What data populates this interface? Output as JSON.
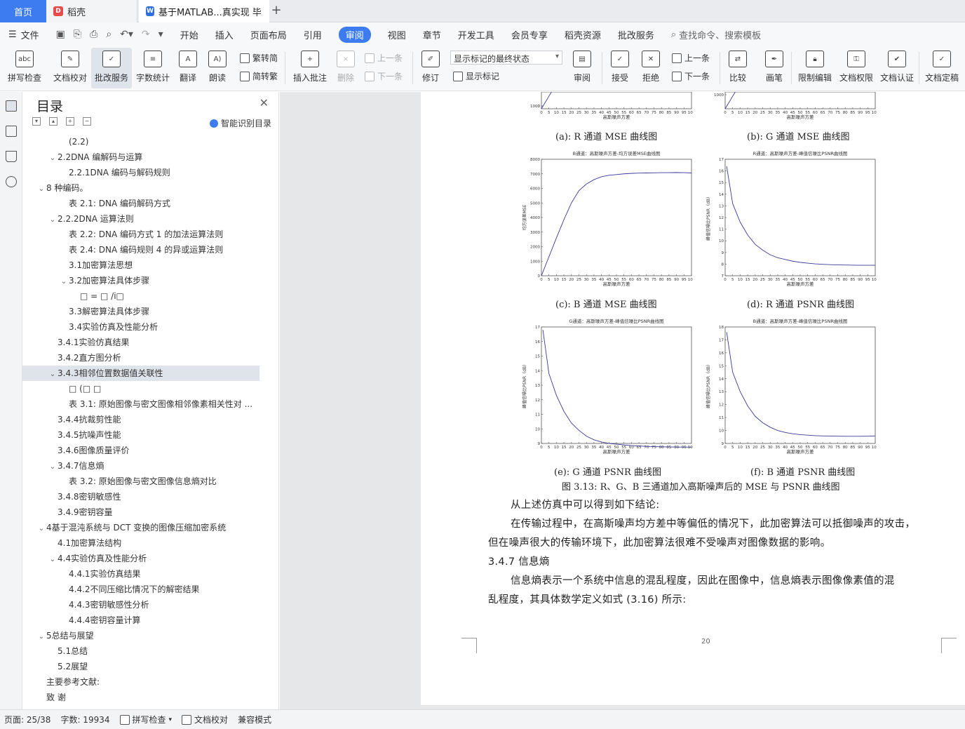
{
  "tabs": {
    "home": "首页",
    "daoke": "稻壳",
    "doc": "基于MATLAB...真实现 毕业论"
  },
  "menubar": {
    "file": "文件",
    "items": [
      "开始",
      "插入",
      "页面布局",
      "引用",
      "审阅",
      "视图",
      "章节",
      "开发工具",
      "会员专享",
      "稻壳资源",
      "批改服务"
    ],
    "active": "审阅",
    "search": "查找命令、搜索模板"
  },
  "ribbon": {
    "spell": "拼写检查",
    "proof": "文档校对",
    "correct": "批改服务",
    "wordcount": "字数统计",
    "translate": "翻译",
    "read": "朗读",
    "t2s": "繁转简",
    "s2t": "简转繁",
    "insert_comment": "插入批注",
    "delete": "删除",
    "prev": "上一条",
    "next": "下一条",
    "revise": "修订",
    "show_state": "显示标记的最终状态",
    "show_marks": "显示标记",
    "review": "审阅",
    "accept": "接受",
    "reject": "拒绝",
    "prev2": "上一条",
    "next2": "下一条",
    "compare": "比较",
    "pen": "画笔",
    "restrict": "限制编辑",
    "permission": "文档权限",
    "certify": "文档认证",
    "finalize": "文档定稿"
  },
  "toc": {
    "title": "目录",
    "smart": "智能识别目录",
    "items": [
      {
        "text": "(2.2)",
        "level": 3,
        "caret": ""
      },
      {
        "text": "2.2DNA 编解码与运算",
        "level": 2,
        "caret": "v"
      },
      {
        "text": "2.2.1DNA 编码与解码规则",
        "level": 3,
        "caret": ""
      },
      {
        "text": "8 种编码。",
        "level": 1,
        "caret": "v"
      },
      {
        "text": "表 2.1:  DNA 编码解码方式",
        "level": 3,
        "caret": ""
      },
      {
        "text": "2.2.2DNA 运算法则",
        "level": 2,
        "caret": "v"
      },
      {
        "text": "表 2.2:  DNA 编码方式 1 的加法运算法则",
        "level": 3,
        "caret": ""
      },
      {
        "text": "表 2.4:  DNA 编码规则 4 的异或运算法则",
        "level": 3,
        "caret": ""
      },
      {
        "text": "3.1加密算法思想",
        "level": 3,
        "caret": ""
      },
      {
        "text": "3.2加密算法具体步骤",
        "level": 3,
        "caret": "v"
      },
      {
        "text": "□ = □  /i□",
        "level": 4,
        "caret": ""
      },
      {
        "text": "3.3解密算法具体步骤",
        "level": 3,
        "caret": ""
      },
      {
        "text": "3.4实验仿真及性能分析",
        "level": 3,
        "caret": ""
      },
      {
        "text": "3.4.1实验仿真结果",
        "level": 2,
        "caret": ""
      },
      {
        "text": "3.4.2直方图分析",
        "level": 2,
        "caret": ""
      },
      {
        "text": "3.4.3相邻位置数据值关联性",
        "level": 2,
        "caret": "v"
      },
      {
        "text": "□  (□ □",
        "level": 3,
        "caret": ""
      },
      {
        "text": "表 3.1:  原始图像与密文图像相邻像素相关性对 ...",
        "level": 3,
        "caret": ""
      },
      {
        "text": "3.4.4抗裁剪性能",
        "level": 2,
        "caret": ""
      },
      {
        "text": "3.4.5抗噪声性能",
        "level": 2,
        "caret": ""
      },
      {
        "text": "3.4.6图像质量评价",
        "level": 2,
        "caret": ""
      },
      {
        "text": "3.4.7信息熵",
        "level": 2,
        "caret": "v"
      },
      {
        "text": "表 3.2:  原始图像与密文图像信息熵对比",
        "level": 3,
        "caret": ""
      },
      {
        "text": "3.4.8密钥敏感性",
        "level": 2,
        "caret": ""
      },
      {
        "text": "3.4.9密钥容量",
        "level": 2,
        "caret": ""
      },
      {
        "text": "4基于混沌系统与 DCT 变换的图像压缩加密系统",
        "level": 1,
        "caret": "v"
      },
      {
        "text": "4.1加密算法结构",
        "level": 2,
        "caret": ""
      },
      {
        "text": "4.4实验仿真及性能分析",
        "level": 2,
        "caret": "v"
      },
      {
        "text": "4.4.1实验仿真结果",
        "level": 3,
        "caret": ""
      },
      {
        "text": "4.4.2不同压缩比情况下的解密结果",
        "level": 3,
        "caret": ""
      },
      {
        "text": "4.4.3密钥敏感性分析",
        "level": 3,
        "caret": ""
      },
      {
        "text": "4.4.4密钥容量计算",
        "level": 3,
        "caret": ""
      },
      {
        "text": "5总结与展望",
        "level": 1,
        "caret": "v"
      },
      {
        "text": "5.1总结",
        "level": 2,
        "caret": ""
      },
      {
        "text": "5.2展望",
        "level": 2,
        "caret": ""
      },
      {
        "text": "主要参考文献:",
        "level": 1,
        "caret": ""
      },
      {
        "text": "致 谢",
        "level": 1,
        "caret": ""
      }
    ],
    "selected_index": 15
  },
  "doc": {
    "cap_a": "(a):  R 通道 MSE 曲线图",
    "cap_b": "(b):  G 通道 MSE 曲线图",
    "cap_c": "(c):  B 通道 MSE 曲线图",
    "cap_d": "(d):  R 通道 PSNR 曲线图",
    "cap_e": "(e):  G 通道 PSNR 曲线图",
    "cap_f": "(f):  B 通道 PSNR 曲线图",
    "figure_caption": "图 3.13:  R、G、B 三通道加入高斯噪声后的 MSE 与 PSNR 曲线图",
    "p1": "从上述仿真中可以得到如下结论:",
    "p2a": "在传输过程中，在高斯噪声均方差中等偏低的情况下，此加密算法可以抵御噪声的攻击，",
    "p2b": "但在噪声很大的传输环境下，此加密算法很难不受噪声对图像数据的影响。",
    "heading": "3.4.7    信息熵",
    "p3a": "信息熵表示一个系统中信息的混乱程度，因此在图像中，信息熵表示图像像素值的混",
    "p3b": "乱程度，其具体数学定义如式 (3.16) 所示:",
    "page_number": "20"
  },
  "chart_data": [
    {
      "type": "line",
      "title": "",
      "xlabel": "高斯噪声方差",
      "ylabel": "",
      "xlim": [
        0,
        100
      ],
      "ylim": [
        0,
        8000
      ],
      "x": [
        0,
        5,
        10,
        15,
        20,
        25,
        30,
        35,
        40,
        45,
        50,
        55,
        60,
        65,
        70,
        75,
        80,
        85,
        90,
        95,
        100
      ],
      "xticks": [
        "0",
        "5",
        "10",
        "15",
        "20",
        "25",
        "30",
        "35",
        "40",
        "45",
        "50",
        "55",
        "60",
        "65",
        "70",
        "75",
        "80",
        "85",
        "90",
        "95",
        "100"
      ],
      "yticks": [
        "0",
        "1000"
      ],
      "series": [
        {
          "values": []
        }
      ]
    },
    {
      "type": "line",
      "title": "",
      "xlabel": "高斯噪声方差",
      "ylabel": "",
      "xlim": [
        0,
        100
      ],
      "ylim": [
        0,
        8000
      ],
      "x": [
        0,
        5,
        10,
        15,
        20,
        25,
        30,
        35,
        40,
        45,
        50,
        55,
        60,
        65,
        70,
        75,
        80,
        85,
        90,
        95,
        100
      ],
      "xticks": [
        "0",
        "5",
        "10",
        "15",
        "20",
        "25",
        "30",
        "35",
        "40",
        "45",
        "50",
        "55",
        "60",
        "65",
        "70",
        "75",
        "80",
        "85",
        "90",
        "95",
        "100"
      ],
      "yticks": [
        "1000"
      ],
      "series": [
        {
          "values": []
        }
      ]
    },
    {
      "type": "line",
      "title": "B通道：高斯噪声方差-均方误差MSE曲线图",
      "xlabel": "高斯噪声方差",
      "ylabel": "均方误差MSE",
      "xlim": [
        0,
        100
      ],
      "ylim": [
        0,
        8000
      ],
      "x": [
        0,
        5,
        10,
        15,
        20,
        25,
        30,
        35,
        40,
        45,
        50,
        55,
        60,
        65,
        70,
        75,
        80,
        85,
        90,
        95,
        100
      ],
      "xticks": [
        "0",
        "5",
        "10",
        "15",
        "20",
        "25",
        "30",
        "35",
        "40",
        "45",
        "50",
        "55",
        "60",
        "65",
        "70",
        "75",
        "80",
        "85",
        "90",
        "95",
        "100"
      ],
      "yticks": [
        "0",
        "1000",
        "2000",
        "3000",
        "4000",
        "5000",
        "6000",
        "7000",
        "8000"
      ],
      "series": [
        {
          "values": [
            0,
            1300,
            2600,
            3850,
            5000,
            5850,
            6300,
            6600,
            6800,
            6900,
            6950,
            7000,
            7030,
            7050,
            7060,
            7070,
            7080,
            7080,
            7090,
            7080,
            7060
          ]
        }
      ]
    },
    {
      "type": "line",
      "title": "R通道：高斯噪声方差-峰值信噪比PSNR曲线图",
      "xlabel": "高斯噪声方差",
      "ylabel": "峰值信噪比PSNR（dB）",
      "xlim": [
        0,
        100
      ],
      "ylim": [
        7,
        17
      ],
      "x": [
        1,
        5,
        10,
        15,
        20,
        25,
        30,
        35,
        40,
        45,
        50,
        55,
        60,
        65,
        70,
        75,
        80,
        85,
        90,
        95,
        100
      ],
      "xticks": [
        "0",
        "5",
        "10",
        "15",
        "20",
        "25",
        "30",
        "35",
        "40",
        "45",
        "50",
        "55",
        "60",
        "65",
        "70",
        "75",
        "80",
        "85",
        "90",
        "95",
        "100"
      ],
      "yticks": [
        "7",
        "8",
        "9",
        "10",
        "11",
        "12",
        "13",
        "14",
        "15",
        "16",
        "17"
      ],
      "series": [
        {
          "values": [
            16.4,
            13.2,
            11.6,
            10.5,
            9.7,
            9.2,
            8.8,
            8.55,
            8.4,
            8.25,
            8.15,
            8.08,
            8.02,
            7.98,
            7.95,
            7.93,
            7.92,
            7.91,
            7.9,
            7.9,
            7.9
          ]
        }
      ]
    },
    {
      "type": "line",
      "title": "G通道：高斯噪声方差-峰值信噪比PSNR曲线图",
      "xlabel": "高斯噪声方差",
      "ylabel": "峰值信噪比PSNR（dB）",
      "xlim": [
        0,
        100
      ],
      "ylim": [
        9,
        17
      ],
      "x": [
        1,
        5,
        10,
        15,
        20,
        25,
        30,
        35,
        40,
        45,
        50,
        55,
        60,
        65,
        70,
        75,
        80,
        85,
        90,
        95,
        100
      ],
      "xticks": [
        "0",
        "5",
        "10",
        "15",
        "20",
        "25",
        "30",
        "35",
        "40",
        "45",
        "50",
        "55",
        "60",
        "65",
        "70",
        "75",
        "80",
        "85",
        "90",
        "95",
        "100"
      ],
      "yticks": [
        "9",
        "10",
        "11",
        "12",
        "13",
        "14",
        "15",
        "16",
        "17"
      ],
      "series": [
        {
          "values": [
            16.8,
            13.8,
            12.3,
            11.2,
            10.4,
            9.9,
            9.5,
            9.25,
            9.1,
            9.0,
            8.95,
            8.9,
            8.85,
            8.82,
            8.8,
            8.78,
            8.77,
            8.76,
            8.75,
            8.75,
            8.75
          ]
        }
      ]
    },
    {
      "type": "line",
      "title": "B通道：高斯噪声方差-峰值信噪比PSNR曲线图",
      "xlabel": "高斯噪声方差",
      "ylabel": "峰值信噪比PSNR（dB）",
      "xlim": [
        0,
        100
      ],
      "ylim": [
        9,
        18
      ],
      "x": [
        1,
        5,
        10,
        15,
        20,
        25,
        30,
        35,
        40,
        45,
        50,
        55,
        60,
        65,
        70,
        75,
        80,
        85,
        90,
        95,
        100
      ],
      "xticks": [
        "0",
        "5",
        "10",
        "15",
        "20",
        "25",
        "30",
        "35",
        "40",
        "45",
        "50",
        "55",
        "60",
        "65",
        "70",
        "75",
        "80",
        "85",
        "90",
        "95",
        "100"
      ],
      "yticks": [
        "9",
        "10",
        "11",
        "12",
        "13",
        "14",
        "15",
        "16",
        "17",
        "18"
      ],
      "series": [
        {
          "values": [
            17.6,
            14.5,
            13.0,
            11.9,
            11.1,
            10.6,
            10.25,
            10.0,
            9.85,
            9.75,
            9.68,
            9.64,
            9.6,
            9.58,
            9.57,
            9.56,
            9.55,
            9.55,
            9.55,
            9.56,
            9.58
          ]
        }
      ]
    }
  ],
  "statusbar": {
    "page": "页面: 25/38",
    "words": "字数: 19934",
    "spell": "拼写检查",
    "proof": "文档校对",
    "compat": "兼容模式"
  }
}
